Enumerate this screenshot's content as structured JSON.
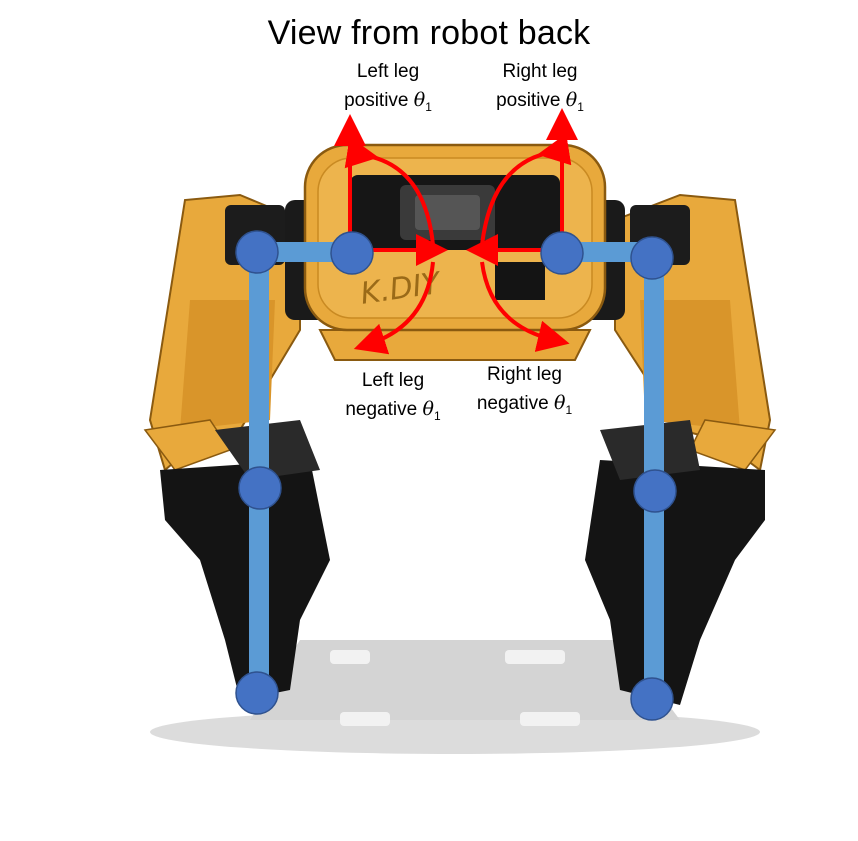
{
  "title": "View from robot back",
  "labels": {
    "left_positive": {
      "line1": "Left leg",
      "line2": "positive",
      "symbol": "θ",
      "sub": "1"
    },
    "right_positive": {
      "line1": "Right leg",
      "line2": "positive",
      "symbol": "θ",
      "sub": "1"
    },
    "left_negative": {
      "line1": "Left leg",
      "line2": "negative",
      "symbol": "θ",
      "sub": "1"
    },
    "right_negative": {
      "line1": "Right leg",
      "line2": "negative",
      "symbol": "θ",
      "sub": "1"
    }
  },
  "body_text": "K.DIY",
  "colors": {
    "body_yellow": "#E8A93C",
    "body_yellow_dark": "#C98A22",
    "motor_black": "#141414",
    "link_blue": "#5B9BD5",
    "joint_blue": "#4472C4",
    "arrow_red": "#FF0000",
    "shadow_gray": "#D9D9D9"
  }
}
